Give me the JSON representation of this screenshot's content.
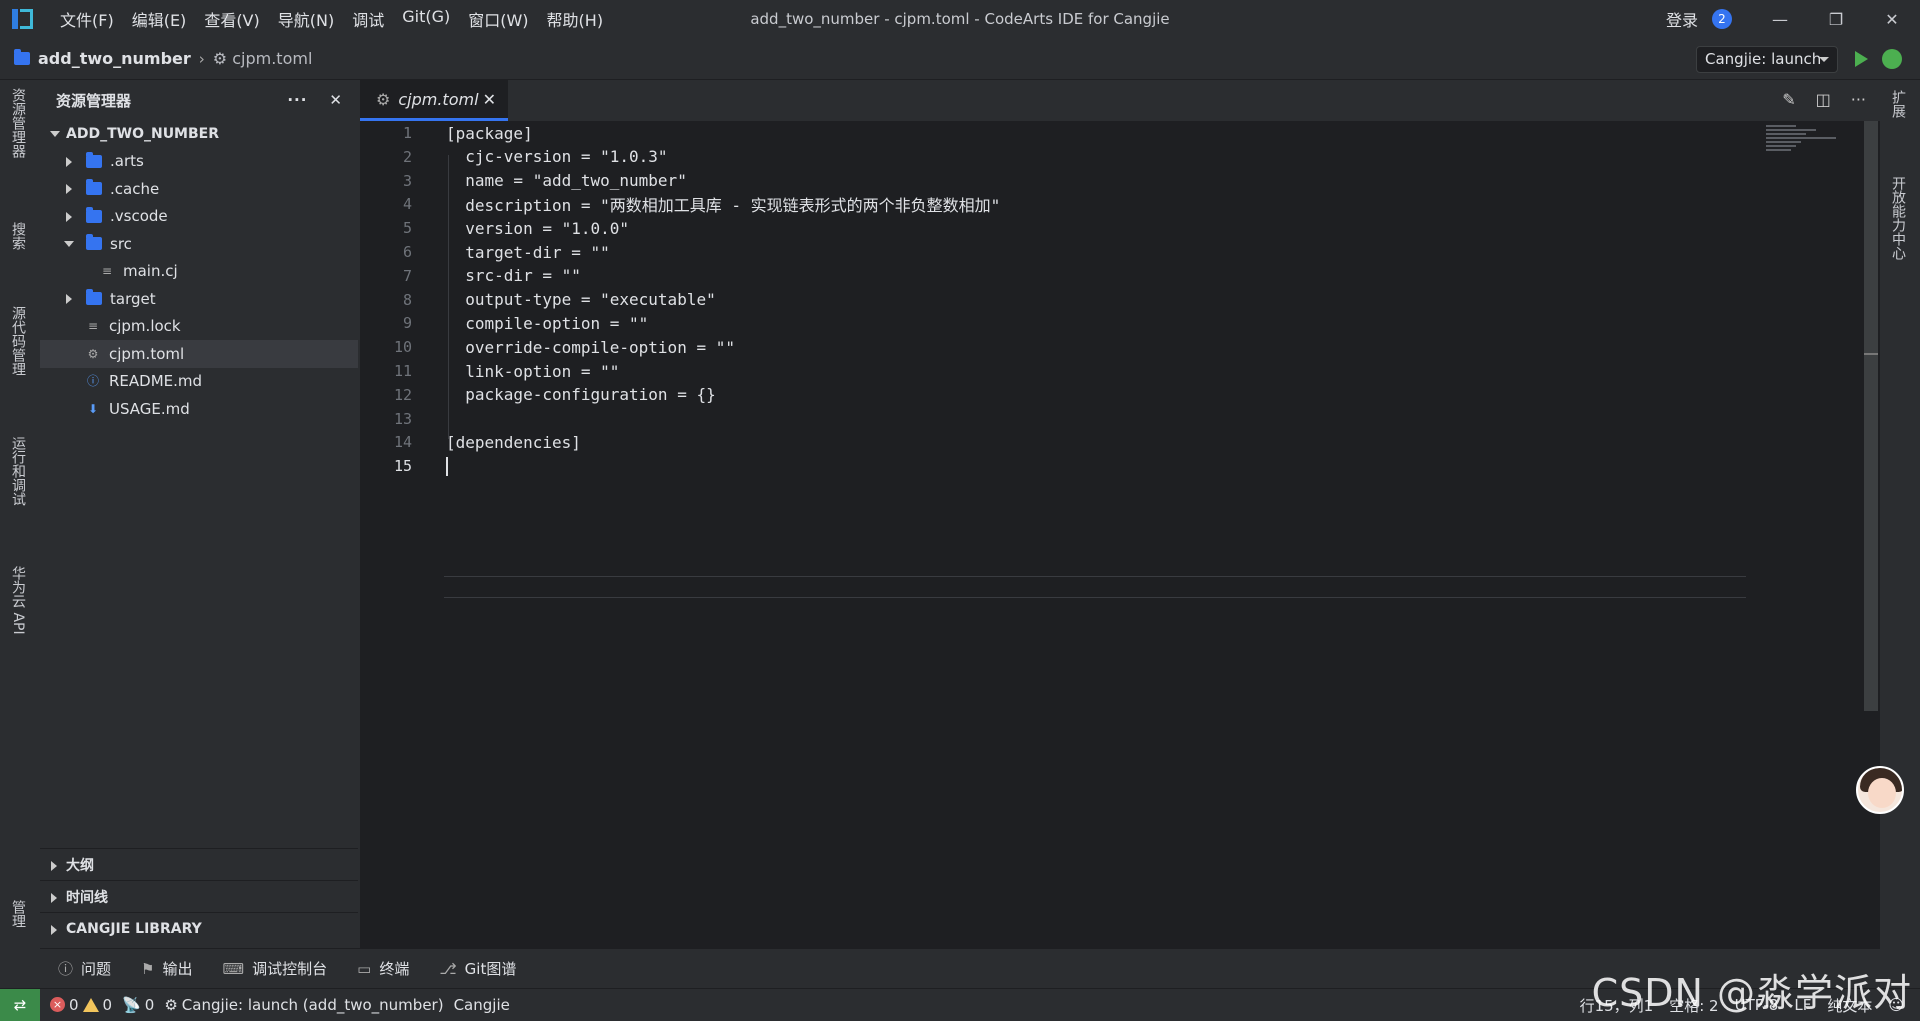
{
  "window": {
    "title": "add_two_number - cjpm.toml - CodeArts IDE for Cangjie",
    "login": "登录",
    "notification_count": "2"
  },
  "menu": [
    "文件(F)",
    "编辑(E)",
    "查看(V)",
    "导航(N)",
    "调试",
    "Git(G)",
    "窗口(W)",
    "帮助(H)"
  ],
  "breadcrumb": {
    "project": "add_two_number",
    "file": "cjpm.toml"
  },
  "run_config": "Cangjie: launch",
  "left_tabs": [
    "资源管理器",
    "搜索",
    "源代码管理",
    "运行和调试",
    "华为云 API",
    "管理"
  ],
  "right_tabs": [
    "扩展",
    "开放能力中心"
  ],
  "explorer": {
    "title": "资源管理器",
    "root": "ADD_TWO_NUMBER",
    "items": [
      {
        "name": ".arts",
        "type": "folder",
        "expanded": false
      },
      {
        "name": ".cache",
        "type": "folder",
        "expanded": false
      },
      {
        "name": ".vscode",
        "type": "folder",
        "expanded": false
      },
      {
        "name": "src",
        "type": "folder",
        "expanded": true
      },
      {
        "name": "main.cj",
        "type": "file"
      },
      {
        "name": "target",
        "type": "folder",
        "expanded": false
      },
      {
        "name": "cjpm.lock",
        "type": "file"
      },
      {
        "name": "cjpm.toml",
        "type": "file",
        "selected": true
      },
      {
        "name": "README.md",
        "type": "file"
      },
      {
        "name": "USAGE.md",
        "type": "file"
      }
    ],
    "panels": [
      "大纲",
      "时间线",
      "CANGJIE LIBRARY"
    ]
  },
  "editor": {
    "tab": "cjpm.toml",
    "lines": [
      "[package]",
      "  cjc-version = \"1.0.3\"",
      "  name = \"add_two_number\"",
      "  description = \"两数相加工具库 - 实现链表形式的两个非负整数相加\"",
      "  version = \"1.0.0\"",
      "  target-dir = \"\"",
      "  src-dir = \"\"",
      "  output-type = \"executable\"",
      "  compile-option = \"\"",
      "  override-compile-option = \"\"",
      "  link-option = \"\"",
      "  package-configuration = {}",
      "",
      "[dependencies]",
      ""
    ],
    "line_numbers": [
      "1",
      "2",
      "3",
      "4",
      "5",
      "6",
      "7",
      "8",
      "9",
      "10",
      "11",
      "12",
      "13",
      "14",
      "15"
    ]
  },
  "tool_windows": [
    "问题",
    "输出",
    "调试控制台",
    "终端",
    "Git图谱"
  ],
  "status": {
    "errors": "0",
    "warnings": "0",
    "ports": "0",
    "launch": "Cangjie: launch (add_two_number)",
    "lang": "Cangjie",
    "position": "行15，列1",
    "spaces": "空格: 2",
    "encoding": "UTF-8",
    "eol": "LF",
    "mode": "纯文本"
  },
  "watermark": "CSDN @淼学派对"
}
